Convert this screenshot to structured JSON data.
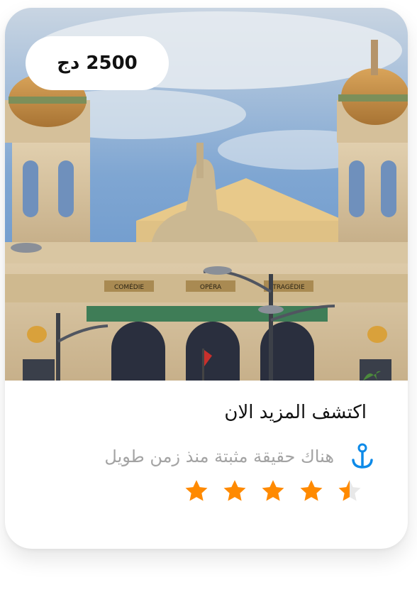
{
  "card": {
    "price": "2500 دج",
    "title": "اكتشف المزيد الان",
    "description": "هناك حقيقة مثبتة منذ زمن طويل",
    "rating": 4.5,
    "rating_max": 5
  },
  "image": {
    "signs": [
      "COMÉDIE",
      "OPÉRA",
      "TRAGÉDIE"
    ]
  },
  "colors": {
    "accent": "#0d8ae8",
    "star": "#ff8a00",
    "star_empty": "#e8e8e8"
  }
}
